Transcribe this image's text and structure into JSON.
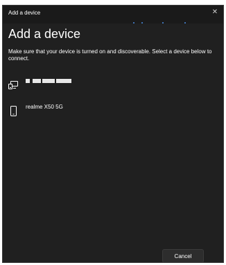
{
  "window": {
    "title": "Add a device",
    "close_icon": "close-icon"
  },
  "header": {
    "heading": "Add a device",
    "description": "Make sure that your device is turned on and discoverable. Select a device below to connect."
  },
  "devices": [
    {
      "name": "",
      "icon": "display-device-icon",
      "name_redacted": true
    },
    {
      "name": "realme X50 5G",
      "icon": "phone-icon",
      "name_redacted": false
    }
  ],
  "footer": {
    "cancel_label": "Cancel"
  },
  "colors": {
    "background": "#202020",
    "titlebar": "#1a1a1a",
    "text": "#ffffff",
    "accent": "#4a8ee6",
    "button": "#2d2d2d"
  }
}
